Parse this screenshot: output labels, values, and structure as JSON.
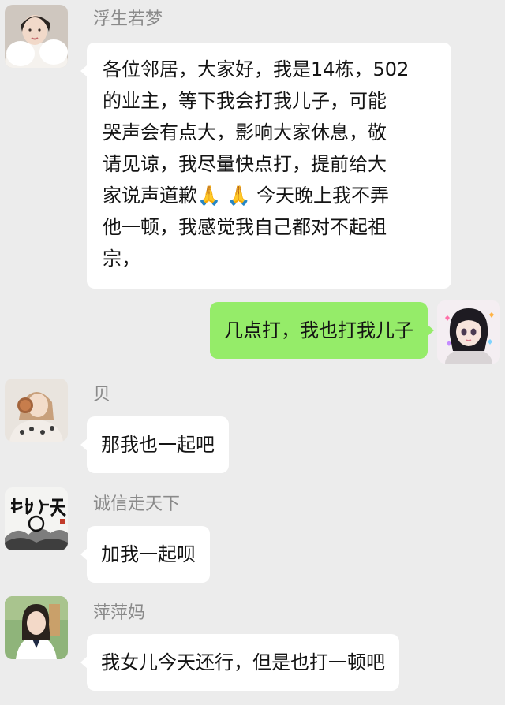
{
  "messages": [
    {
      "sender": "浮生若梦",
      "text_lines": [
        "各位邻居，大家好，我是14栋，502",
        "的业主，等下我会打我儿子，可能",
        "哭声会有点大，影响大家休息，敬",
        "请见谅，我尽量快点打，提前给大",
        "家说声道歉",
        "今天晚上我不弄",
        "他一顿，我感觉我自己都对不起祖",
        "宗，"
      ],
      "emoji": "🙏",
      "avatar": "avatar-woman-white-fur"
    },
    {
      "sender": "",
      "text": "几点打，我也打我儿子",
      "avatar": "avatar-anime-girl",
      "mine": true
    },
    {
      "sender": "贝",
      "text": "那我也一起吧",
      "avatar": "avatar-girl-floral"
    },
    {
      "sender": "诚信走天下",
      "text": "加我一起呗",
      "avatar": "avatar-calligraphy-landscape"
    },
    {
      "sender": "萍萍妈",
      "text": "我女儿今天还行，但是也打一顿吧",
      "avatar": "avatar-woman-uniform"
    }
  ],
  "colors": {
    "background": "#ececec",
    "bubble": "#ffffff",
    "mine_bubble": "#95ec69",
    "name": "#8a8a8a",
    "text": "#141414"
  }
}
